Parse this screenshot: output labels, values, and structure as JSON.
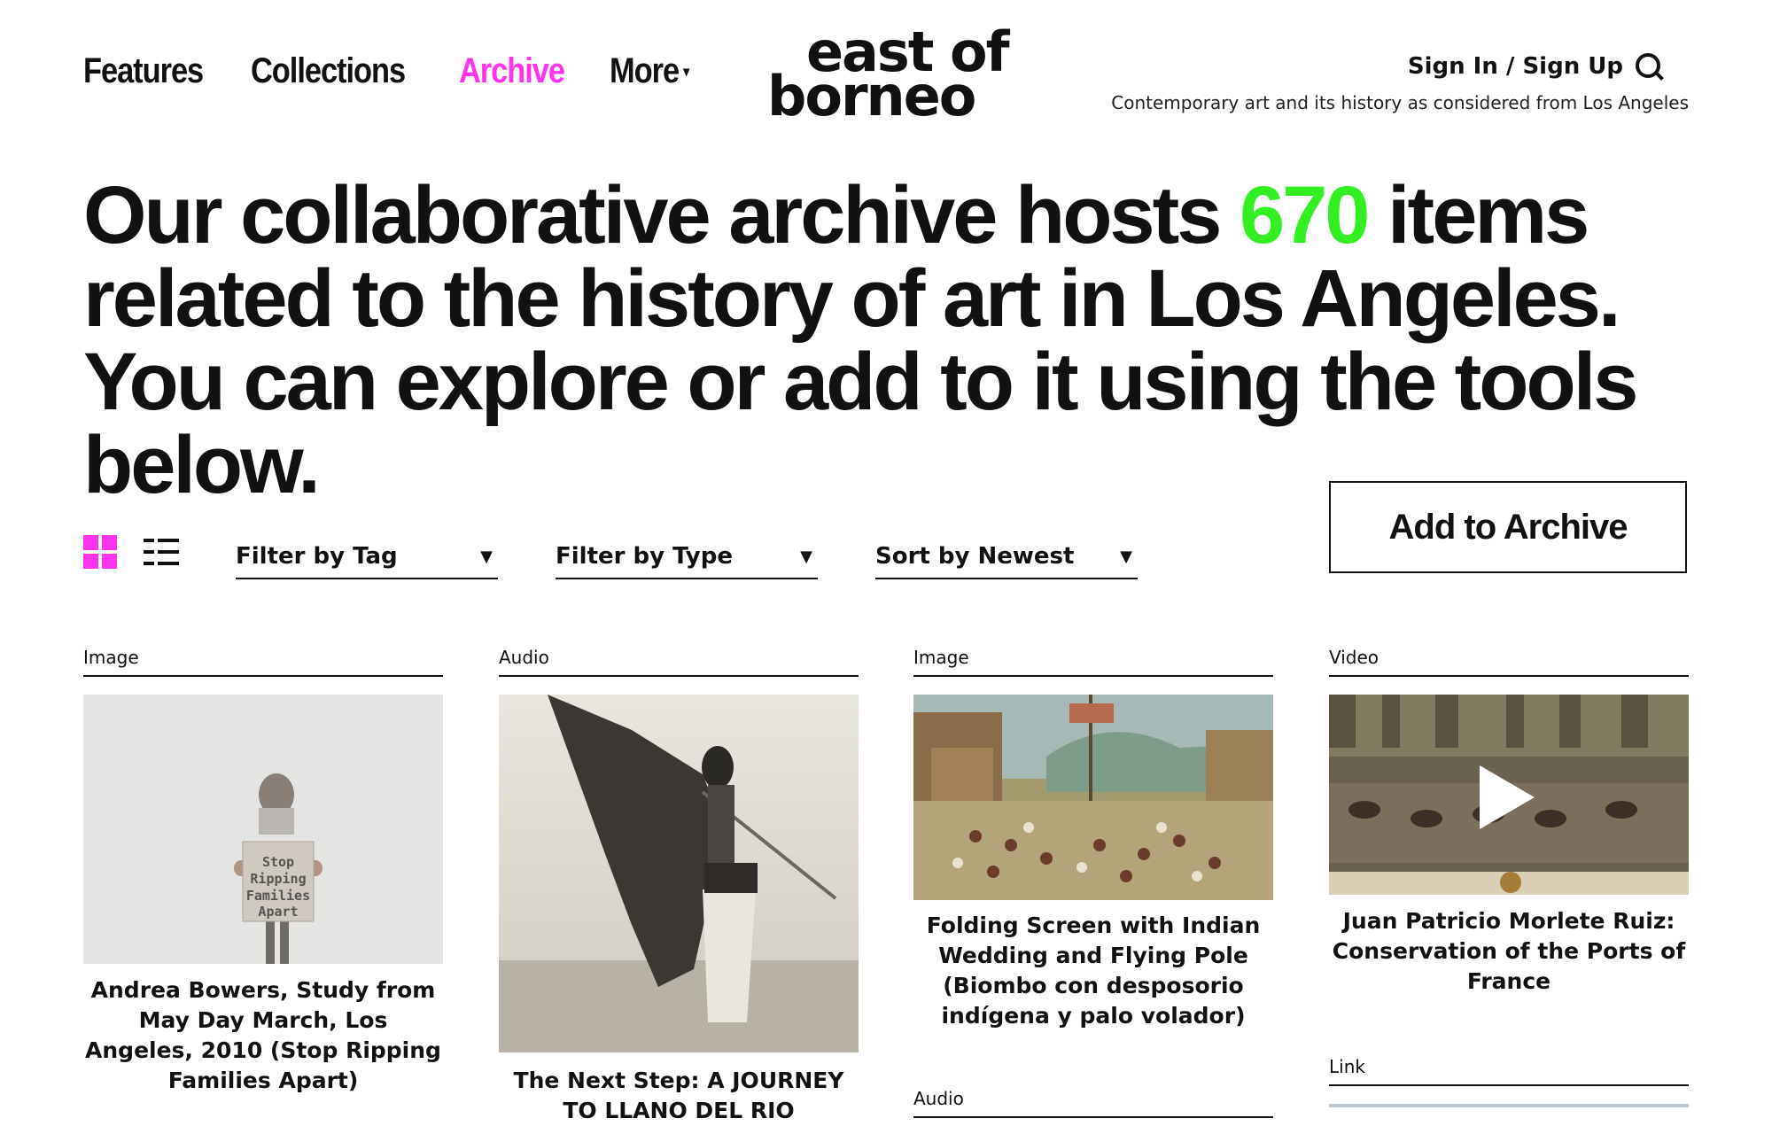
{
  "nav": {
    "items": [
      {
        "label": "Features"
      },
      {
        "label": "Collections"
      },
      {
        "label": "Archive"
      },
      {
        "label": "More"
      }
    ]
  },
  "logo": {
    "line1": "east of",
    "line2": "borneo"
  },
  "header": {
    "signin": "Sign In / Sign Up",
    "tagline": "Contemporary art and its history as considered from Los Angeles"
  },
  "headline": {
    "before": "Our collaborative archive hosts ",
    "count": "670",
    "after": " items related to the history of art in Los Angeles. You can explore or add to it using the tools below."
  },
  "controls": {
    "filter_tag": "Filter by Tag",
    "filter_type": "Filter by Type",
    "sort": "Sort by Newest",
    "add_button": "Add to Archive"
  },
  "cards": [
    {
      "type": "Image",
      "title": "Andrea Bowers, Study from May Day March, Los Angeles, 2010 (Stop Ripping Families Apart)",
      "sign": "Stop Ripping Families Apart"
    },
    {
      "type": "Audio",
      "title": "The Next Step: A JOURNEY TO LLANO DEL RIO"
    },
    {
      "type": "Image",
      "title": "Folding Screen with Indian Wedding and Flying Pole (Biombo con desposorio indígena y palo volador)"
    },
    {
      "type": "Video",
      "title": "Juan Patricio Morlete Ruiz: Conservation of the Ports of France"
    }
  ],
  "more_cards": [
    {
      "type": "Link"
    },
    {
      "type": "Audio"
    }
  ],
  "colors": {
    "accent": "#ff33ee",
    "count": "#33ee22"
  }
}
